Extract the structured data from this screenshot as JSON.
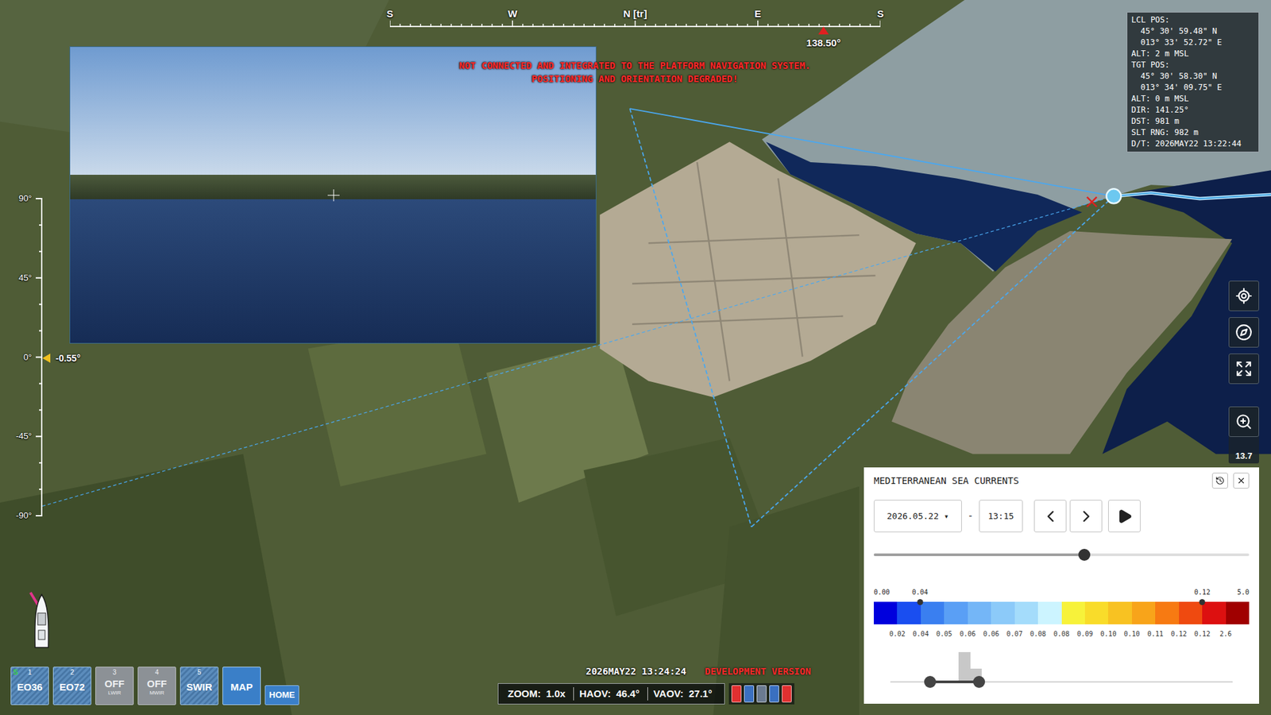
{
  "compass": {
    "labels": [
      "S",
      "W",
      "N [tr]",
      "E",
      "S"
    ],
    "heading": "138.50°",
    "heading_level": 0.884
  },
  "warning": [
    "NOT CONNECTED AND INTEGRATED TO THE PLATFORM NAVIGATION SYSTEM.",
    "POSITIONING AND ORIENTATION DEGRADED!"
  ],
  "info_box": [
    {
      "text": "LCL POS:",
      "indent": false
    },
    {
      "text": "45° 30' 59.48\" N",
      "indent": true
    },
    {
      "text": "013° 33' 52.72\" E",
      "indent": true
    },
    {
      "text": "ALT: 2 m MSL",
      "indent": false
    },
    {
      "text": "TGT POS:",
      "indent": false
    },
    {
      "text": "45° 30' 58.30\" N",
      "indent": true
    },
    {
      "text": "013° 34' 09.75\" E",
      "indent": true
    },
    {
      "text": "ALT: 0 m MSL",
      "indent": false
    },
    {
      "text": "DIR: 141.25°",
      "indent": false
    },
    {
      "text": "DST: 981 m",
      "indent": false
    },
    {
      "text": "SLT RNG: 982 m",
      "indent": false
    },
    {
      "text": "D/T: 2026MAY22 13:22:44",
      "indent": false
    }
  ],
  "pitch_scale": {
    "labels": [
      "90°",
      "45°",
      "0°",
      "-45°",
      "-90°"
    ],
    "reading": "-0.55°",
    "level": 0.497
  },
  "zoom_level": "13.7",
  "sea_currents": {
    "title": "MEDITERRANEAN SEA CURRENTS",
    "date": "2026.05.22",
    "date_arrow": "▾",
    "separator": "-",
    "time": "13:15",
    "time_slider": {
      "level": 0.56
    },
    "scale": {
      "min_label": "0.00",
      "max_label": "5.0",
      "low": {
        "label": "0.04",
        "level": 0.123
      },
      "high": {
        "label": "0.12",
        "level": 0.875
      },
      "cells": [
        {
          "color": "#0000dd"
        },
        {
          "color": "#1a4ef0"
        },
        {
          "color": "#3a7ff0"
        },
        {
          "color": "#5a9ff5"
        },
        {
          "color": "#74b6f7"
        },
        {
          "color": "#8ccaf9"
        },
        {
          "color": "#a4dcfb"
        },
        {
          "color": "#ccf4ff"
        },
        {
          "color": "#f7f23a"
        },
        {
          "color": "#f9dc2a"
        },
        {
          "color": "#f8c222"
        },
        {
          "color": "#f8a41a"
        },
        {
          "color": "#f77a12"
        },
        {
          "color": "#ef4a10"
        },
        {
          "color": "#dd1010"
        },
        {
          "color": "#a00000"
        }
      ],
      "boundary_labels": [
        "0.02",
        "0.04",
        "0.05",
        "0.06",
        "0.06",
        "0.07",
        "0.08",
        "0.08",
        "0.09",
        "0.10",
        "0.10",
        "0.11",
        "0.12",
        "0.12",
        "2.6"
      ]
    },
    "range": {
      "low": 0.116,
      "high": 0.26
    },
    "histogram": [
      0,
      0,
      0,
      0,
      0,
      0,
      1.0,
      0.45,
      0,
      0,
      0,
      0,
      0,
      0,
      0,
      0,
      0,
      0,
      0,
      0,
      0,
      0,
      0,
      0,
      0,
      0,
      0,
      0,
      0,
      0
    ]
  },
  "sensor_buttons": [
    {
      "kind": "sensor",
      "number": "1",
      "label": "EO36",
      "badge": "S",
      "on": true,
      "selected": false
    },
    {
      "kind": "sensor",
      "number": "2",
      "label": "EO72",
      "on": true,
      "selected": false
    },
    {
      "kind": "sensor",
      "number": "3",
      "label": "OFF",
      "sub": "LWIR",
      "on": false,
      "selected": false
    },
    {
      "kind": "sensor",
      "number": "4",
      "label": "OFF",
      "sub": "MWIR",
      "on": false,
      "selected": false
    },
    {
      "kind": "sensor",
      "number": "5",
      "label": "SWIR",
      "on": true,
      "selected": false
    },
    {
      "kind": "view",
      "label": "MAP",
      "on": true,
      "selected": true
    },
    {
      "kind": "home",
      "label": "HOME",
      "on": true,
      "selected": false
    }
  ],
  "clock": "2026MAY22 13:24:24",
  "build_label": "DEVELOPMENT VERSION",
  "status_bar": {
    "items": [
      {
        "label": "ZOOM:",
        "value": "1.0x"
      },
      {
        "label": "HAOV:",
        "value": "46.4°"
      },
      {
        "label": "VAOV:",
        "value": "27.1°"
      }
    ],
    "meters": [
      {
        "color": "#e03030"
      },
      {
        "color": "#3a70c0"
      },
      {
        "color": "#6a7a90"
      },
      {
        "color": "#3a70c0"
      },
      {
        "color": "#e03030"
      }
    ]
  }
}
